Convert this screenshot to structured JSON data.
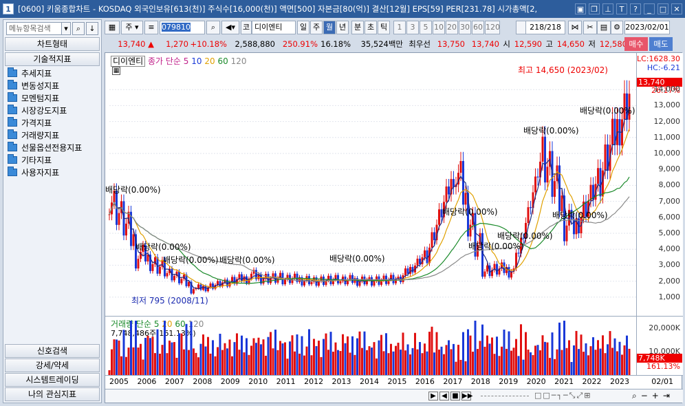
{
  "window": {
    "icon": "1",
    "title": "[0600] 키움종합차트 - KOSDAQ 외국인보유[613(천)] 주식수[16,000(천)] 액면[500] 자본금[80(억)] 결산[12월] EPS[59] PER[231.78] 시가총액[2,"
  },
  "left": {
    "search_placeholder": "메뉴항목검색",
    "chart_type": "차트형태",
    "tech": "기술적지표",
    "items": [
      "추세지표",
      "변동성지표",
      "모멘텀지표",
      "시장강도지표",
      "가격지표",
      "거래량지표",
      "선물옵션전용지표",
      "기타지표",
      "사용자지표"
    ],
    "bottom": [
      "신호검색",
      "강세/약세",
      "시스템트레이딩",
      "나의 관심지표"
    ]
  },
  "toolbar": {
    "type1": "주",
    "code": "079810",
    "kind": "코",
    "name": "디이엔티",
    "periods": [
      "일",
      "주",
      "월",
      "년",
      "분",
      "초",
      "틱"
    ],
    "nums": [
      "1",
      "3",
      "5",
      "10",
      "20",
      "30",
      "60",
      "120"
    ],
    "count": "218/218",
    "date": "2023/02/01",
    "buy": "매수",
    "sell": "매도"
  },
  "info": {
    "price": "13,740 ▲",
    "change": "1,270",
    "rate": "+10.18%",
    "volume": "2,588,880",
    "vrate": "250.91%",
    "turn": "16.18%",
    "cap": "35,524백만",
    "best": "최우선",
    "b1": "13,750",
    "b2": "13,740",
    "open_l": "시",
    "open": "12,590",
    "high_l": "고",
    "high": "14,650",
    "low_l": "저",
    "low": "12,580"
  },
  "legend": {
    "name": "디이엔티",
    "ma": "종가 단순 5",
    "m10": "10",
    "m20": "20",
    "m60": "60",
    "m120": "120",
    "vol": "거래량 단순 5",
    "v20": "20",
    "v60": "60",
    "v120": "120",
    "vinfo": "7,748,486주(161.13%)"
  },
  "axis": {
    "lc": "LC:1628.30",
    "hc": "HC:-6.21",
    "last": "13,740",
    "lastpct": "26.17%",
    "vlast": "7,748K",
    "vpct": "161.13%"
  },
  "annotations": {
    "high": "최고 14,650 (2023/02)",
    "low": "최저 795 (2008/11)",
    "div": "배당락(0.00%)"
  },
  "xaxis_end": "02/01",
  "chart_data": {
    "type": "candlestick",
    "x": [
      "2005",
      "2006",
      "2007",
      "2008",
      "2009",
      "2010",
      "2011",
      "2012",
      "2013",
      "2014",
      "2015",
      "2016",
      "2017",
      "2018",
      "2019",
      "2020",
      "2021",
      "2022",
      "2023"
    ],
    "ylim": [
      0,
      15000
    ],
    "yticks": [
      1000,
      2000,
      3000,
      4000,
      5000,
      6000,
      7000,
      8000,
      9000,
      10000,
      11000,
      12000,
      13000,
      14000
    ],
    "close_approx": [
      7500,
      3800,
      2600,
      1500,
      1900,
      2300,
      2100,
      2100,
      2000,
      2100,
      2000,
      3800,
      9000,
      2700,
      2700,
      10000,
      5000,
      8500,
      13740
    ],
    "vol_ticks": [
      "10,000K",
      "20,000K"
    ]
  }
}
